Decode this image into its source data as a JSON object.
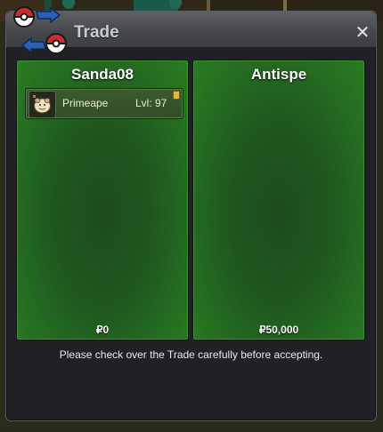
{
  "window": {
    "title": "Trade",
    "close_icon": "✕"
  },
  "trade": {
    "left": {
      "player_name": "Sanda08",
      "offer": [
        {
          "pokemon": "Primeape",
          "level_label": "Lvl: 97",
          "icon": "primeape-sprite-icon",
          "held_item": true
        }
      ],
      "money": "₽0"
    },
    "right": {
      "player_name": "Antispe",
      "offer": [],
      "money": "₽50,000"
    }
  },
  "notice": "Please check over the Trade carefully before accepting.",
  "colors": {
    "panel_green": "#2a7d22",
    "title_text": "#c9ccd1",
    "held_item": "#e1b838"
  }
}
